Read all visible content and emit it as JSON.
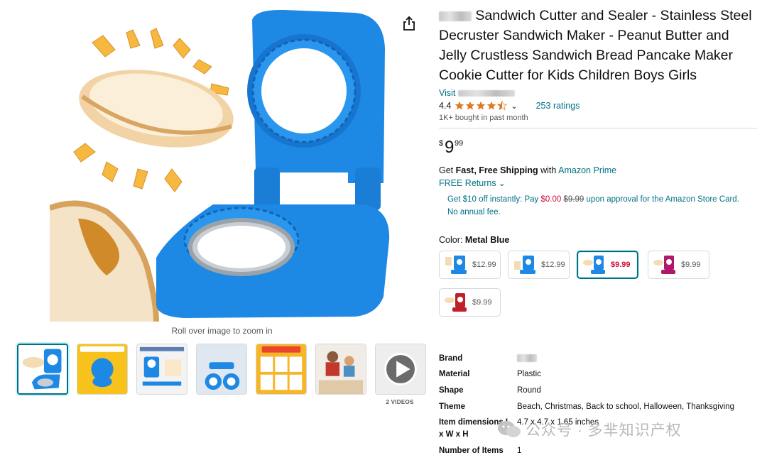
{
  "gallery": {
    "zoom_hint": "Roll over image to zoom in",
    "videos_label": "2 VIDEOS",
    "thumbnails": [
      {
        "name": "thumb-main"
      },
      {
        "name": "thumb-patented-design",
        "caption": "Upgraded Patented Design"
      },
      {
        "name": "thumb-sandwich-cutter",
        "caption": "AIYZ Sandwich Cutter"
      },
      {
        "name": "thumb-easy-clean",
        "caption": "EASY TO CLEAN"
      },
      {
        "name": "thumb-easy-to-use",
        "caption": "EASY TO USE!"
      },
      {
        "name": "thumb-family"
      },
      {
        "name": "thumb-video"
      }
    ]
  },
  "product": {
    "title": "Sandwich Cutter and Sealer - Stainless Steel Decruster Sandwich Maker - Peanut Butter and Jelly Crustless Sandwich Bread Pancake Maker Cookie Cutter for Kids Children Boys Girls",
    "visit_label": "Visit",
    "rating_value": "4.4",
    "rating_count": "253 ratings",
    "bought": "1K+ bought in past month",
    "price_symbol": "$",
    "price_whole": "9",
    "price_fraction": "99",
    "shipping_prefix": "Get",
    "shipping_bold": "Fast, Free Shipping",
    "shipping_mid": "with",
    "shipping_link": "Amazon Prime",
    "returns": "FREE Returns",
    "card_offer_1": "Get $10 off instantly: Pay",
    "card_offer_price": "$0.00",
    "card_offer_old": "$9.99",
    "card_offer_2": "upon approval for the Amazon Store Card.",
    "card_offer_3": "No annual fee.",
    "color_label": "Color:",
    "color_value": "Metal Blue"
  },
  "swatches": [
    {
      "price": "$12.99",
      "color": "#1e88e5"
    },
    {
      "price": "$12.99",
      "color": "#1e88e5"
    },
    {
      "price": "$9.99",
      "color": "#1e88e5",
      "selected": true
    },
    {
      "price": "$9.99",
      "color": "#b0186a"
    },
    {
      "price": "$9.99",
      "color": "#c0202a"
    }
  ],
  "specs": [
    {
      "key": "Brand",
      "value": ""
    },
    {
      "key": "Material",
      "value": "Plastic"
    },
    {
      "key": "Shape",
      "value": "Round"
    },
    {
      "key": "Theme",
      "value": "Beach, Christmas, Back to school, Halloween, Thanksgiving"
    },
    {
      "key": "Item dimensions L x W x H",
      "value": "4.7 x 4.7 x 1.65 inches"
    },
    {
      "key": "Number of Items",
      "value": "1"
    }
  ],
  "watermark": {
    "text": "公众号 · 多芈知识产权"
  },
  "colors": {
    "link": "#007185",
    "price_red": "#cc0c39",
    "product_blue": "#1e88e5"
  }
}
